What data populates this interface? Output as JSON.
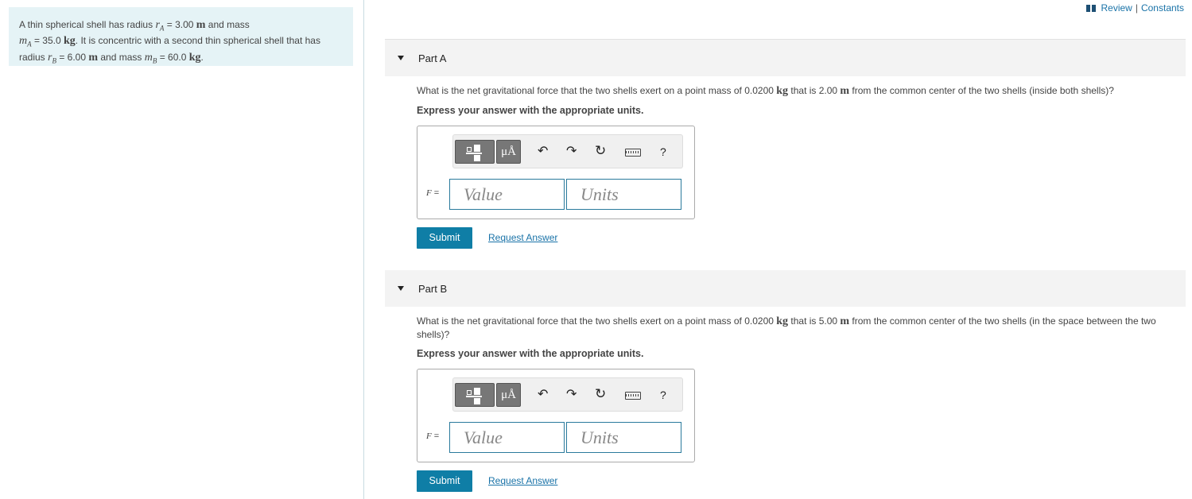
{
  "header": {
    "review_label": "Review",
    "separator": "|",
    "constants_label": "Constants"
  },
  "intro": {
    "t1": "A thin spherical shell has radius ",
    "rA_sym": "r",
    "rA_sub": "A",
    "t2": " = 3.00 ",
    "unit_m": "m",
    "t3": " and mass",
    "mA_sym": "m",
    "mA_sub": "A",
    "t4": " = 35.0 ",
    "unit_kg": "kg",
    "t5": ". It is concentric with a second thin spherical shell that has radius ",
    "rB_sym": "r",
    "rB_sub": "B",
    "t6": " = 6.00 ",
    "t7": " and mass ",
    "mB_sym": "m",
    "mB_sub": "B",
    "t8": " = 60.0 ",
    "t9": "."
  },
  "parts": [
    {
      "title": "Part A",
      "q1": "What is the net gravitational force that the two shells exert on a point mass of 0.0200 ",
      "q_kg": "kg",
      "q2": " that is 2.00 ",
      "q_m": "m",
      "q3": " from the common center of the two shells (inside both shells)?",
      "instruction": "Express your answer with the appropriate units.",
      "var_label": "F",
      "eq": " =",
      "value_placeholder": "Value",
      "units_placeholder": "Units",
      "submit_label": "Submit",
      "request_label": "Request Answer"
    },
    {
      "title": "Part B",
      "q1": "What is the net gravitational force that the two shells exert on a point mass of 0.0200 ",
      "q_kg": "kg",
      "q2": " that is 5.00 ",
      "q_m": "m",
      "q3": " from the common center of the two shells (in the space between the two shells)?",
      "instruction": "Express your answer with the appropriate units.",
      "var_label": "F",
      "eq": " =",
      "value_placeholder": "Value",
      "units_placeholder": "Units",
      "submit_label": "Submit",
      "request_label": "Request Answer"
    }
  ],
  "toolbar": {
    "units_button_label": "μÅ",
    "undo_glyph": "↶",
    "redo_glyph": "↷",
    "reset_glyph": "↻",
    "help_glyph": "?"
  },
  "icons": {
    "review": "book-icon",
    "templates": "templates-icon",
    "units": "units-icon",
    "undo": "undo-icon",
    "redo": "redo-icon",
    "reset": "reset-icon",
    "keyboard": "keyboard-icon",
    "help": "help-icon",
    "collapse": "collapse-triangle-icon"
  },
  "colors": {
    "accent": "#0f7ea6",
    "intro_bg": "#e5f3f6",
    "link": "#1a73a8"
  }
}
